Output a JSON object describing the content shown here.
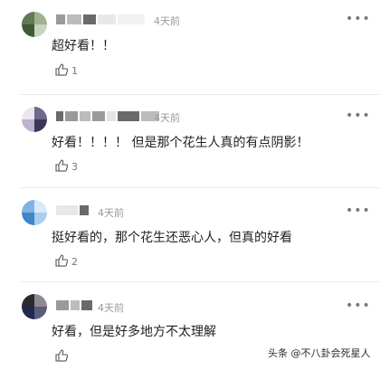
{
  "icons": {
    "more": "more-dots-icon",
    "like": "thumbs-up-icon"
  },
  "comments": [
    {
      "time": "4天前",
      "more": "•••",
      "text": "超好看！！",
      "likes": "1"
    },
    {
      "time": "4天前",
      "more": "•••",
      "text": "好看！！！！ 但是那个花生人真的有点阴影！",
      "likes": "3"
    },
    {
      "time": "4天前",
      "more": "•••",
      "text": "挺好看的，那个花生还恶心人，但真的好看",
      "likes": "2"
    },
    {
      "time": "4天前",
      "more": "•••",
      "text": "好看，但是好多地方不太理解",
      "likes": ""
    }
  ],
  "watermark": "头条 @不八卦会死星人"
}
